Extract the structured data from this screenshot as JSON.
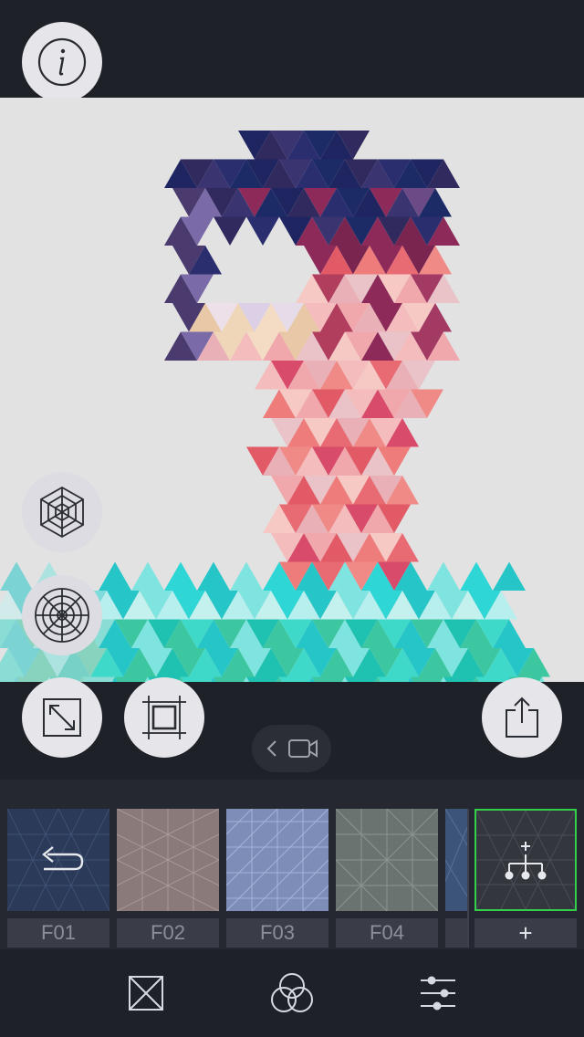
{
  "app": {
    "accent_color": "#33d14a",
    "background_color": "#1f2129"
  },
  "top_bar": {
    "info_button_icon": "info-icon"
  },
  "canvas": {
    "description_icon": "triangle-mosaic-artwork"
  },
  "side_tools": {
    "mesh_hex_icon": "spider-web-hexagon-icon",
    "mesh_circle_icon": "spider-web-circle-icon"
  },
  "tools": {
    "expand_icon": "expand-arrows-icon",
    "crop_icon": "crop-frame-icon",
    "video_back_icon": "chevron-left-icon",
    "video_icon": "video-camera-icon",
    "share_icon": "share-icon"
  },
  "filters": {
    "items": [
      {
        "label": "F01",
        "color": "#2a3a58",
        "icon": "undo-arrow-icon"
      },
      {
        "label": "F02",
        "color": "#8a7a7a"
      },
      {
        "label": "F03",
        "color": "#7d8db8"
      },
      {
        "label": "F04",
        "color": "#6a7370"
      }
    ],
    "add_label": "+",
    "add_icon": "hierarchy-plus-icon"
  },
  "bottom_nav": {
    "items": [
      {
        "icon": "square-x-icon"
      },
      {
        "icon": "color-circles-icon"
      },
      {
        "icon": "sliders-icon"
      }
    ]
  }
}
